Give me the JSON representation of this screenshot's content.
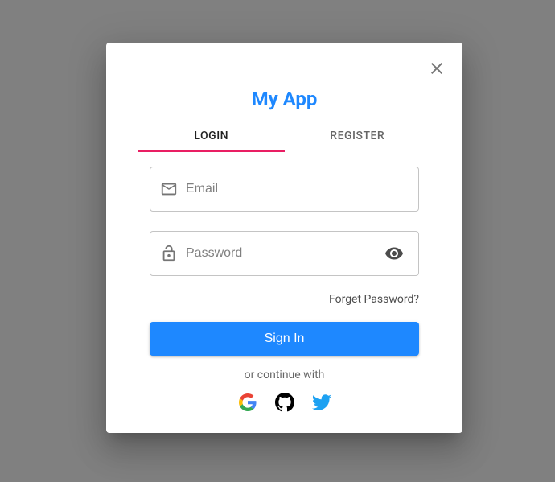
{
  "app": {
    "title": "My App"
  },
  "tabs": {
    "login": "Login",
    "register": "Register"
  },
  "form": {
    "email_placeholder": "Email",
    "password_placeholder": "Password",
    "forget_label": "Forget Password?",
    "signin_label": "Sign In",
    "continue_label": "or continue with"
  },
  "social": {
    "google": "Google",
    "github": "GitHub",
    "twitter": "Twitter"
  }
}
